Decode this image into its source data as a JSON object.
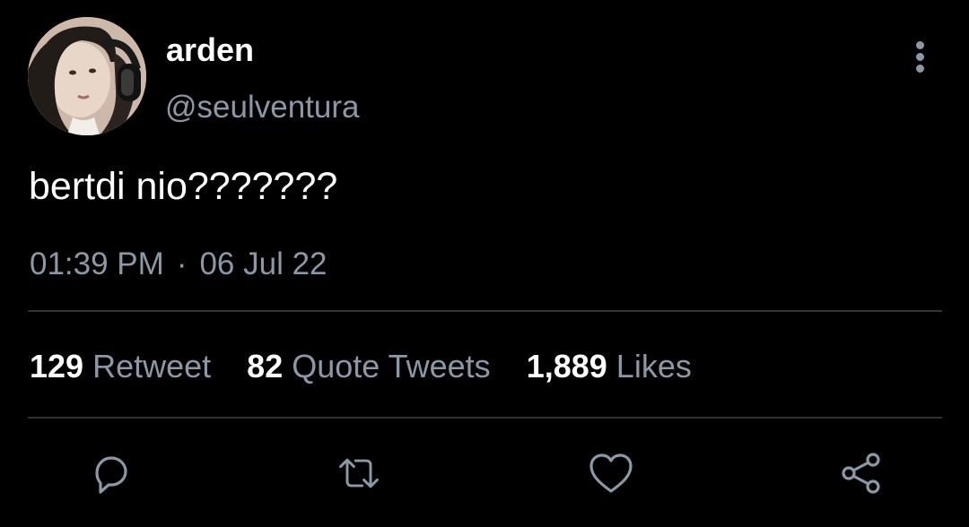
{
  "tweet": {
    "author": {
      "display_name": "arden",
      "handle": "@seulventura"
    },
    "text": "bertdi nio???????",
    "time": "01:39 PM",
    "separator": "·",
    "date": "06 Jul 22",
    "stats": {
      "retweets": {
        "count": "129",
        "label": "Retweet"
      },
      "quotes": {
        "count": "82",
        "label": "Quote Tweets"
      },
      "likes": {
        "count": "1,889",
        "label": "Likes"
      }
    }
  },
  "icons": {
    "more": "more-vertical-icon",
    "reply": "reply-icon",
    "retweet": "retweet-icon",
    "like": "heart-icon",
    "share": "share-icon"
  },
  "colors": {
    "background": "#000000",
    "text_primary": "#ffffff",
    "text_secondary": "#8b98a5",
    "divider": "#2f3336"
  }
}
